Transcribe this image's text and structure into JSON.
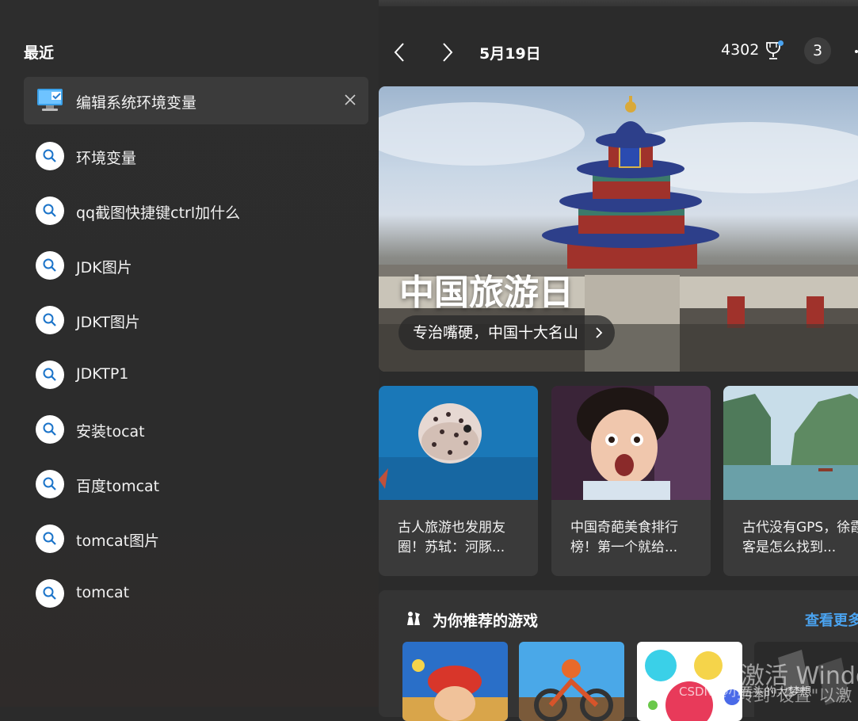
{
  "left": {
    "title": "最近",
    "pinned": {
      "label": "编辑系统环境变量",
      "icon": "system-monitor-icon"
    },
    "searches": [
      "环境变量",
      "qq截图快捷键ctrl加什么",
      "JDK图片",
      "JDKT图片",
      "JDKTP1",
      "安装tocat",
      "百度tomcat",
      "tomcat图片",
      "tomcat"
    ]
  },
  "nav": {
    "date": "5月19日",
    "points": "4302",
    "badge": "3"
  },
  "hero": {
    "title": "中国旅游日",
    "pill": "专治嘴硬，中国十大名山"
  },
  "cards": [
    {
      "text": "古人旅游也发朋友圈！苏轼：河豚..."
    },
    {
      "text": "中国奇葩美食排行榜！第一个就给..."
    },
    {
      "text": "古代没有GPS，徐霞客是怎么找到..."
    }
  ],
  "games": {
    "title": "为你推荐的游戏",
    "more": "查看更多"
  },
  "watermark": {
    "line1": "激活 Windo",
    "line2": "转到\"设置\"以激",
    "csdn": "CSDN @小石头的大梦想"
  },
  "colors": {
    "accent": "#4aa3f0",
    "panel": "#2b2b2b",
    "card": "#3a3a3a"
  }
}
